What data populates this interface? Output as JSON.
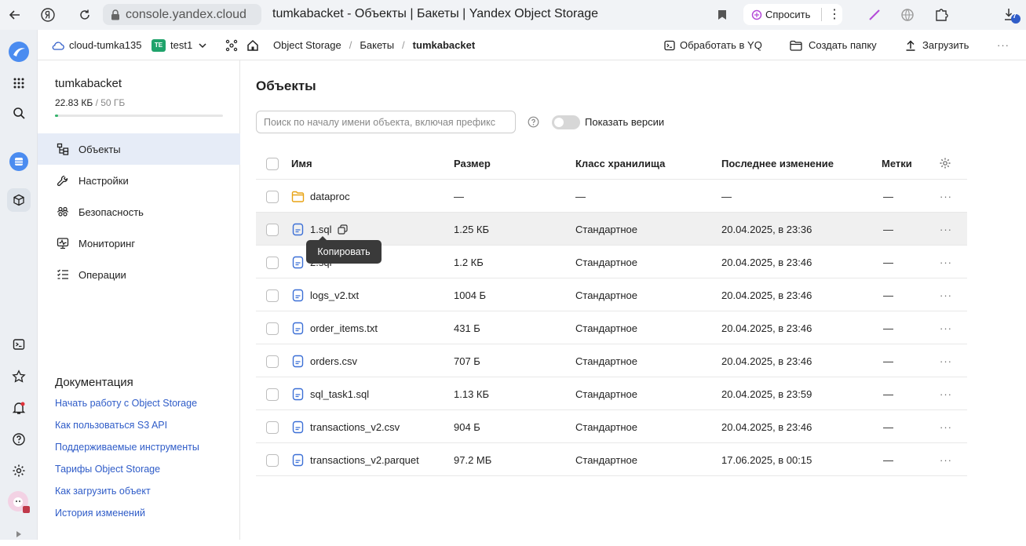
{
  "browser": {
    "url": "console.yandex.cloud",
    "title": "tumkabacket - Объекты | Бакеты | Yandex Object Storage",
    "ask_label": "Спросить",
    "download_badge": "7"
  },
  "topbar": {
    "cloud": "cloud-tumka135",
    "folder_badge": "TE",
    "folder": "test1",
    "crumbs": [
      "Object Storage",
      "Бакеты",
      "tumkabacket"
    ],
    "actions": {
      "yq": "Обработать в YQ",
      "create_folder": "Создать папку",
      "upload": "Загрузить"
    }
  },
  "sidebar": {
    "bucket_name": "tumkabacket",
    "used": "22.83 КБ",
    "limit": "/ 50 ГБ",
    "usage_fraction": 0.02,
    "nav": [
      {
        "label": "Объекты",
        "icon": "objects-icon",
        "active": true
      },
      {
        "label": "Настройки",
        "icon": "wrench-icon",
        "active": false
      },
      {
        "label": "Безопасность",
        "icon": "users-icon",
        "active": false
      },
      {
        "label": "Мониторинг",
        "icon": "monitor-icon",
        "active": false
      },
      {
        "label": "Операции",
        "icon": "list-icon",
        "active": false
      }
    ],
    "docs_title": "Документация",
    "docs": [
      "Начать работу с Object Storage",
      "Как пользоваться S3 API",
      "Поддерживаемые инструменты",
      "Тарифы Object Storage",
      "Как загрузить объект",
      "История изменений"
    ]
  },
  "main": {
    "title": "Объекты",
    "search_placeholder": "Поиск по началу имени объекта, включая префикс",
    "show_versions": "Показать версии",
    "columns": [
      "Имя",
      "Размер",
      "Класс хранилища",
      "Последнее изменение",
      "Метки"
    ],
    "rows": [
      {
        "name": "dataproc",
        "type": "folder",
        "size": "—",
        "class": "—",
        "modified": "—",
        "tags": "—"
      },
      {
        "name": "1.sql",
        "type": "file",
        "size": "1.25 КБ",
        "class": "Стандартное",
        "modified": "20.04.2025, в 23:36",
        "tags": "—",
        "hover": true
      },
      {
        "name": "2.sql",
        "type": "file",
        "size": "1.2 КБ",
        "class": "Стандартное",
        "modified": "20.04.2025, в 23:46",
        "tags": "—"
      },
      {
        "name": "logs_v2.txt",
        "type": "file",
        "size": "1004 Б",
        "class": "Стандартное",
        "modified": "20.04.2025, в 23:46",
        "tags": "—"
      },
      {
        "name": "order_items.txt",
        "type": "file",
        "size": "431 Б",
        "class": "Стандартное",
        "modified": "20.04.2025, в 23:46",
        "tags": "—"
      },
      {
        "name": "orders.csv",
        "type": "file",
        "size": "707 Б",
        "class": "Стандартное",
        "modified": "20.04.2025, в 23:46",
        "tags": "—"
      },
      {
        "name": "sql_task1.sql",
        "type": "file",
        "size": "1.13 КБ",
        "class": "Стандартное",
        "modified": "20.04.2025, в 23:59",
        "tags": "—"
      },
      {
        "name": "transactions_v2.csv",
        "type": "file",
        "size": "904 Б",
        "class": "Стандартное",
        "modified": "20.04.2025, в 23:46",
        "tags": "—"
      },
      {
        "name": "transactions_v2.parquet",
        "type": "file",
        "size": "97.2 МБ",
        "class": "Стандартное",
        "modified": "17.06.2025, в 00:15",
        "tags": "—"
      }
    ],
    "row_menu": "···",
    "tooltip": "Копировать"
  },
  "colors": {
    "accent": "#2f5cc8",
    "active_nav": "#e6ecf7",
    "folder": "#e8a313",
    "file": "#3b6fd6",
    "progress": "#33b36b"
  }
}
